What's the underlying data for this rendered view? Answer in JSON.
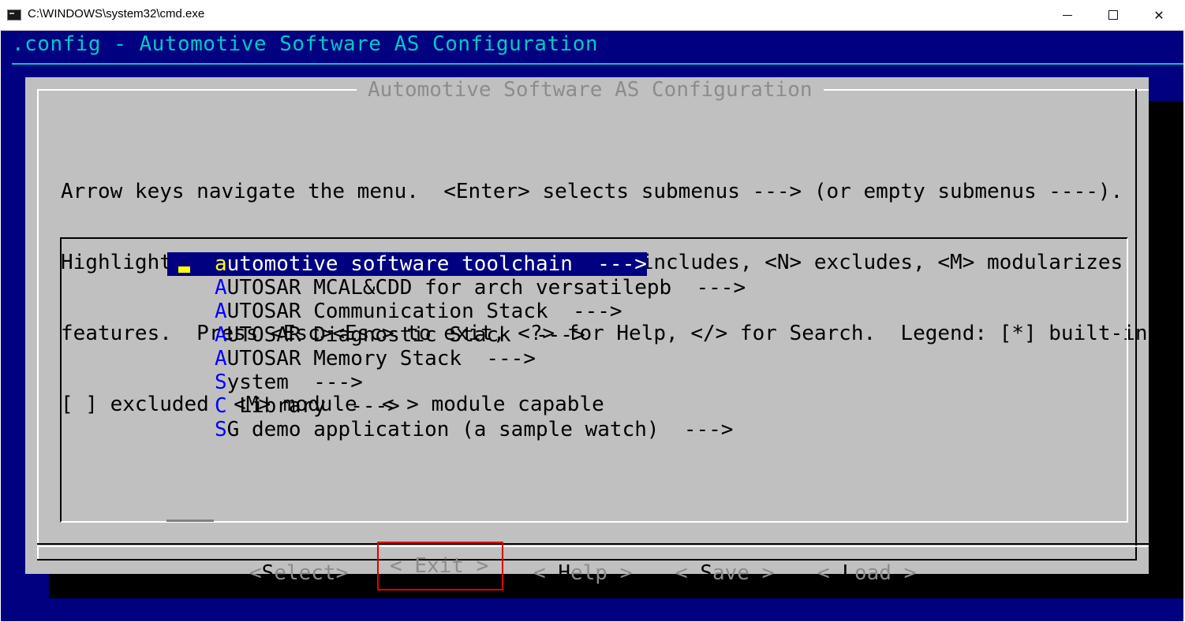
{
  "window": {
    "title": "C:\\WINDOWS\\system32\\cmd.exe",
    "controls": {
      "minimize": "—",
      "maximize": "☐",
      "close": "✕"
    }
  },
  "config_header": ".config - Automotive Software AS Configuration",
  "dialog": {
    "title": "Automotive Software AS Configuration",
    "help_lines": [
      "Arrow keys navigate the menu.  <Enter> selects submenus ---> (or empty submenus ----).",
      "Highlighted letters are hotkeys.  Pressing <Y> includes, <N> excludes, <M> modularizes",
      "features.  Press <Esc><Esc> to exit, <?> for Help, </> for Search.  Legend: [*] built-in",
      "[ ] excluded  <M> module  < > module capable"
    ]
  },
  "menu": {
    "items": [
      {
        "hotkey": "a",
        "rest": "utomotive software toolchain  --->",
        "selected": true
      },
      {
        "hotkey": "A",
        "rest": "UTOSAR MCAL&CDD for arch versatilepb  --->",
        "selected": false
      },
      {
        "hotkey": "A",
        "rest": "UTOSAR Communication Stack  --->",
        "selected": false
      },
      {
        "hotkey": "A",
        "rest": "UTOSAR Diagnostic Stack  --->",
        "selected": false
      },
      {
        "hotkey": "A",
        "rest": "UTOSAR Memory Stack  --->",
        "selected": false
      },
      {
        "hotkey": "S",
        "rest": "ystem  --->",
        "selected": false
      },
      {
        "hotkey": "C",
        "rest": " Library  --->",
        "selected": false
      },
      {
        "hotkey": "S",
        "rest": "G demo application (a sample watch)  --->",
        "selected": false
      }
    ]
  },
  "buttons": {
    "select": {
      "pre": "<",
      "hotkey": "S",
      "post": "elect>"
    },
    "exit": {
      "pre": "< ",
      "hotkey": "E",
      "post": "xit >"
    },
    "help": {
      "pre": "< ",
      "hotkey": "H",
      "post": "elp >"
    },
    "save": {
      "pre": "< ",
      "hotkey": "S",
      "post": "ave >"
    },
    "load": {
      "pre": "< ",
      "hotkey": "L",
      "post": "oad >"
    }
  },
  "colors": {
    "console_bg": "#000080",
    "header_text": "#00c8c8",
    "dialog_bg": "#c0c0c0",
    "hotkey": "#0000ff",
    "selected_bg": "#000080",
    "highlight_box": "#e00000"
  }
}
